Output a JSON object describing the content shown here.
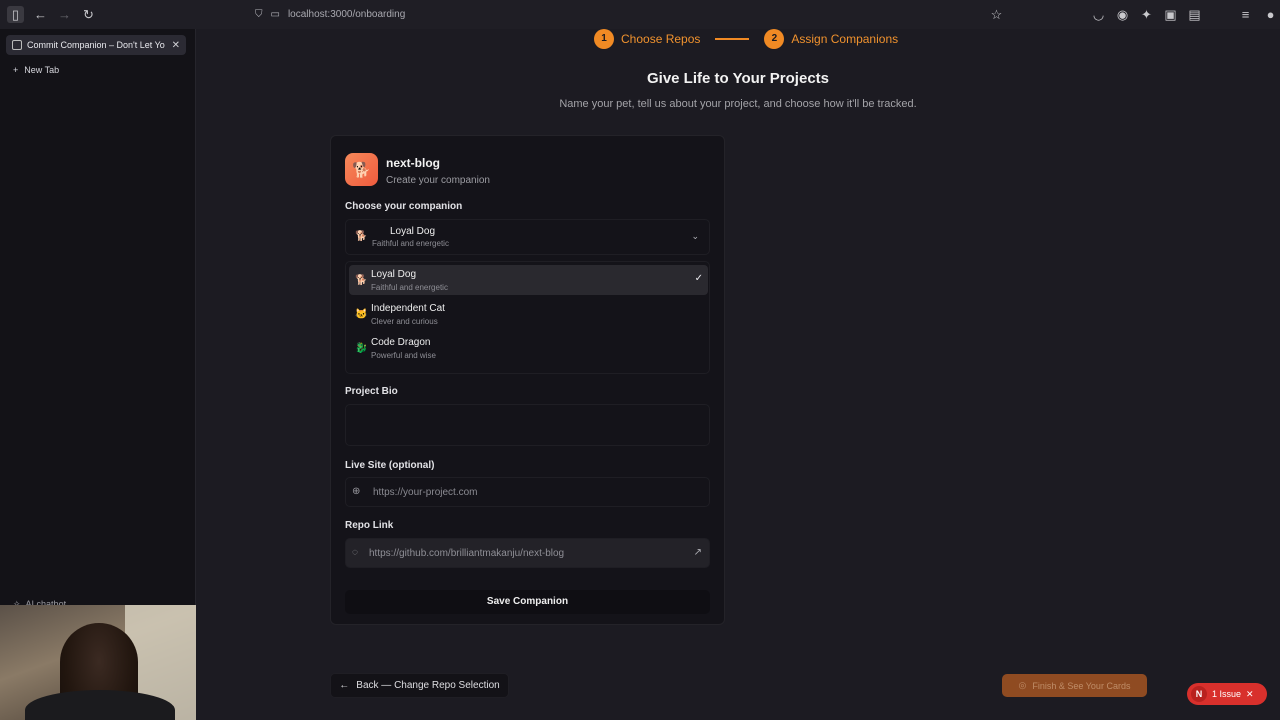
{
  "browser": {
    "url": "localhost:3000/onboarding",
    "tab_title": "Commit Companion – Don't Let Yo",
    "new_tab_label": "New Tab",
    "ai_chatbot_label": "AI chatbot"
  },
  "stepper": {
    "step1_num": "1",
    "step1_label": "Choose Repos",
    "step2_num": "2",
    "step2_label": "Assign Companions"
  },
  "page": {
    "title": "Give Life to Your Projects",
    "subtitle": "Name your pet, tell us about your project, and choose how it'll be tracked."
  },
  "card": {
    "repo_name": "next-blog",
    "repo_sub": "Create your companion",
    "companion_label": "Choose your companion",
    "selected": {
      "name": "Loyal Dog",
      "desc": "Faithful and energetic"
    },
    "options": [
      {
        "name": "Loyal Dog",
        "desc": "Faithful and energetic",
        "icon": "dog-icon",
        "selected": true
      },
      {
        "name": "Independent Cat",
        "desc": "Clever and curious",
        "icon": "cat-icon",
        "selected": false
      },
      {
        "name": "Code Dragon",
        "desc": "Powerful and wise",
        "icon": "dragon-icon",
        "selected": false
      }
    ],
    "bio_label": "Project Bio",
    "live_label": "Live Site (optional)",
    "live_placeholder": "https://your-project.com",
    "repo_label": "Repo Link",
    "repo_value": "https://github.com/brilliantmakanju/next-blog",
    "save_label": "Save Companion"
  },
  "footer": {
    "back_label": "Back — Change Repo Selection",
    "finish_label": "Finish & See Your Cards",
    "issue_label": "1 Issue",
    "issue_avatar": "N"
  },
  "colors": {
    "accent": "#f08a24",
    "issue": "#d8302c"
  }
}
